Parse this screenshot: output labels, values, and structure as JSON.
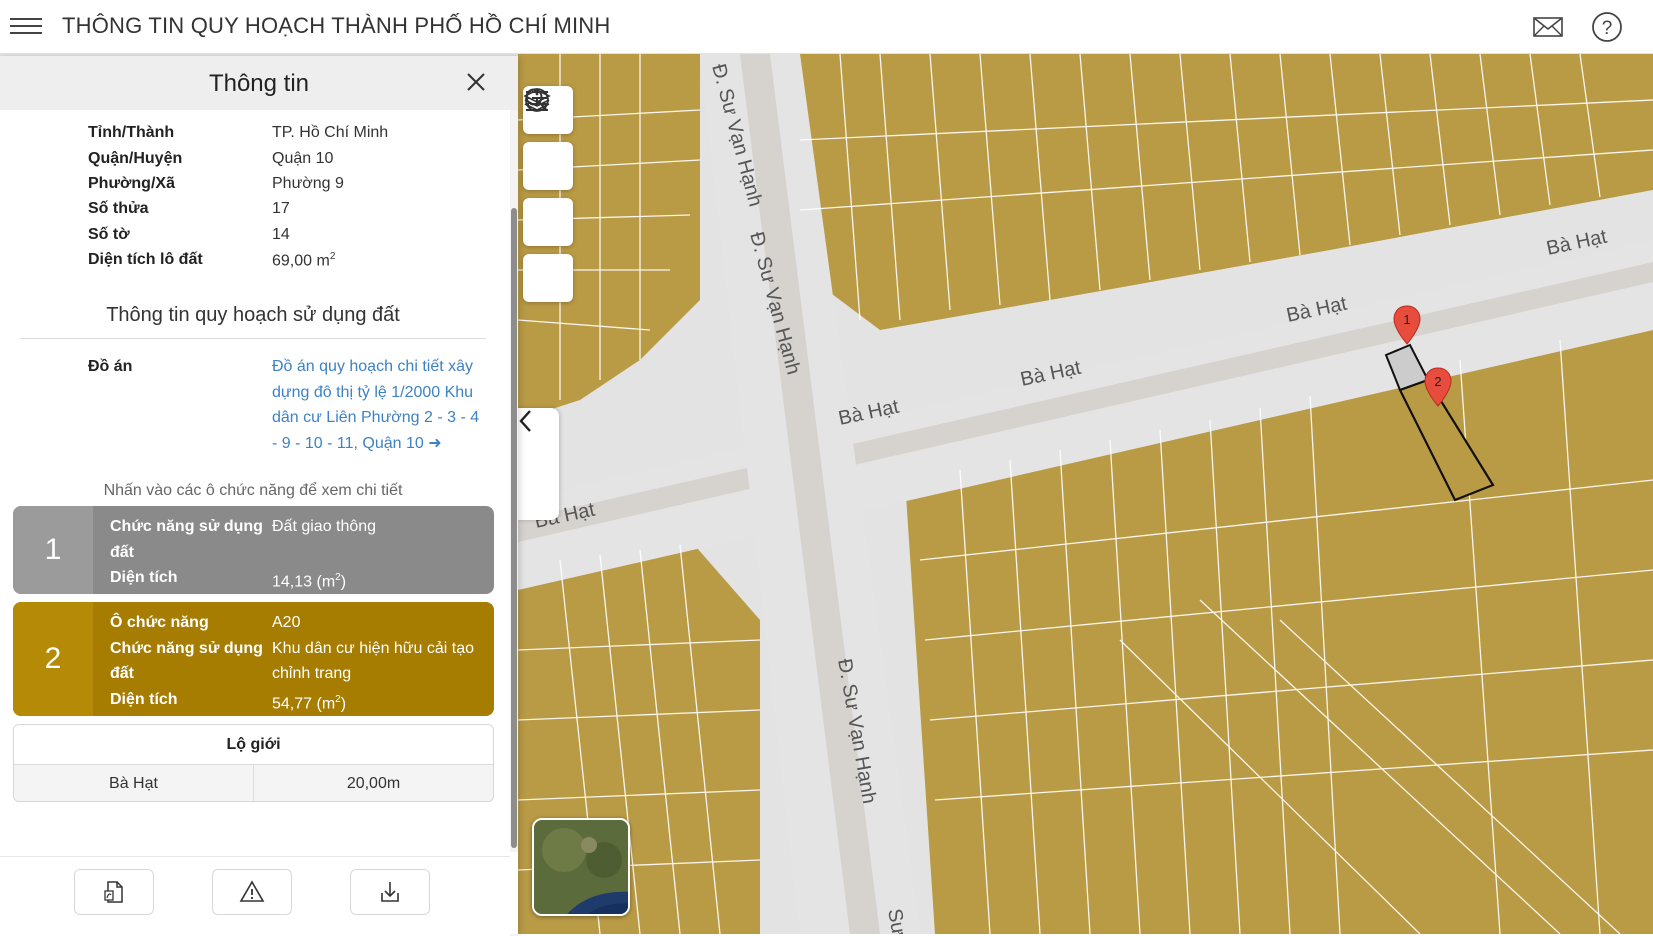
{
  "app": {
    "title": "THÔNG TIN QUY HOẠCH THÀNH PHỐ HỒ CHÍ MINH",
    "icons": [
      "menu-icon",
      "mail-icon",
      "help-icon"
    ]
  },
  "panel": {
    "title": "Thông tin",
    "info": [
      {
        "label": "Tỉnh/Thành",
        "value": "TP. Hồ Chí Minh"
      },
      {
        "label": "Quận/Huyện",
        "value": "Quận 10"
      },
      {
        "label": "Phường/Xã",
        "value": "Phường 9"
      },
      {
        "label": "Số thửa",
        "value": "17"
      },
      {
        "label": "Số tờ",
        "value": "14"
      },
      {
        "label": "Diện tích lô đất",
        "value": "69,00 m",
        "sup": "2"
      }
    ],
    "section_title": "Thông tin quy hoạch sử dụng đất",
    "do_an_label": "Đồ án",
    "do_an_link": "Đồ án quy hoạch chi tiết xây dựng đô thị tỷ lệ 1/2000 Khu dân cư Liên Phường 2 - 3 - 4 - 9 - 10 - 11, Quận 10",
    "hint": "Nhấn vào các ô chức năng để xem chi tiết",
    "cards": [
      {
        "num": "1",
        "color": "#8a8a8a",
        "rows": [
          {
            "k": "Chức năng sử dụng đất",
            "v": "Đất giao thông"
          },
          {
            "k": "Diện tích",
            "v": "14,13 (m",
            "sup": "2",
            "tail": ")"
          }
        ]
      },
      {
        "num": "2",
        "color": "#a67d00",
        "rows": [
          {
            "k": "Ô chức năng",
            "v": "A20"
          },
          {
            "k": "Chức năng sử dụng đất",
            "v": "Khu dân cư hiện hữu cải tạo chỉnh trang"
          },
          {
            "k": "Diện tích",
            "v": "54,77 (m",
            "sup": "2",
            "tail": ")"
          }
        ]
      }
    ],
    "lo_gioi": {
      "header": "Lộ giới",
      "street": "Bà Hạt",
      "width": "20,00m"
    }
  },
  "map": {
    "street_labels": [
      "Đ. Sư Vạn Hạnh",
      "Đ. Sư Vạn Hạnh",
      "Đ. Sư Vạn Hạnh",
      "Bà Hạt",
      "Bà Hạt",
      "Bà Hạt",
      "Bà Hạt",
      "Bà Hạt",
      "Sư"
    ],
    "markers": [
      "1",
      "2"
    ],
    "colors": {
      "parcel": "#b99a45",
      "road": "#e4e4e4",
      "roadCore": "#d6d3cf",
      "marker": "#e84c3d"
    }
  }
}
